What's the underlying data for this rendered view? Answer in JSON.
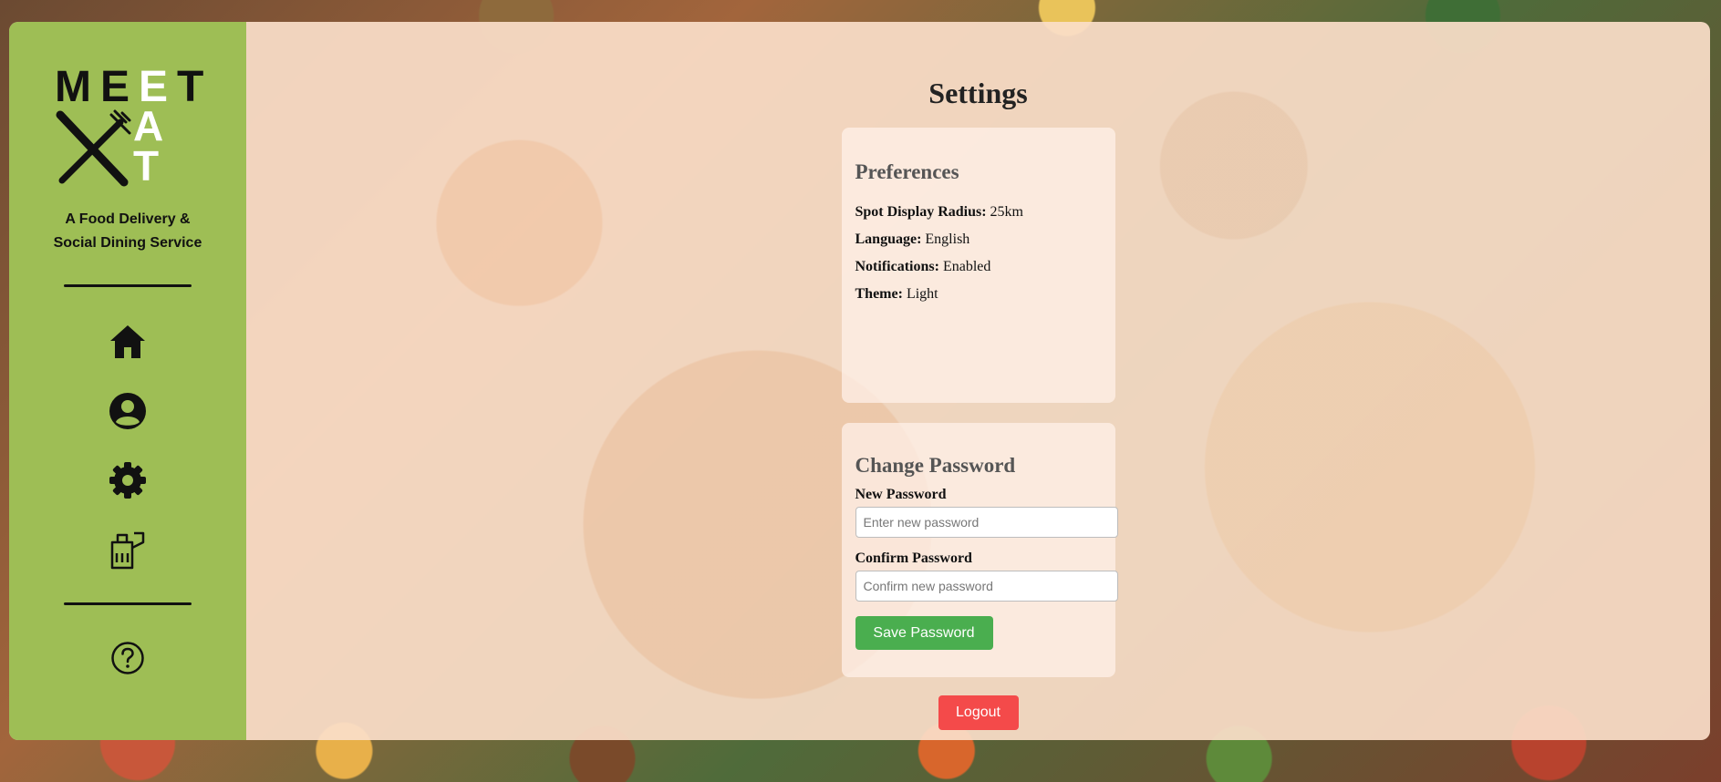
{
  "brand": {
    "logo_letters_top": [
      "M",
      "E",
      "E",
      "T"
    ],
    "logo_letters_side": [
      "A",
      "T"
    ],
    "tagline": "A Food Delivery & Social Dining Service",
    "accent_color": "#9ebe55"
  },
  "sidebar": {
    "nav": [
      {
        "icon": "home-icon"
      },
      {
        "icon": "profile-icon"
      },
      {
        "icon": "gear-icon"
      },
      {
        "icon": "takeout-bag-icon"
      }
    ],
    "help_icon": "help-icon"
  },
  "main": {
    "title": "Settings",
    "preferences": {
      "heading": "Preferences",
      "rows": [
        {
          "label": "Spot Display Radius:",
          "value": "25km"
        },
        {
          "label": "Language:",
          "value": "English"
        },
        {
          "label": "Notifications:",
          "value": "Enabled"
        },
        {
          "label": "Theme:",
          "value": "Light"
        }
      ]
    },
    "change_password": {
      "heading": "Change Password",
      "new_label": "New Password",
      "new_placeholder": "Enter new password",
      "confirm_label": "Confirm Password",
      "confirm_placeholder": "Confirm new password",
      "save_label": "Save Password",
      "save_color": "#4aae4f"
    },
    "logout_label": "Logout",
    "logout_color": "#f44a4a"
  }
}
